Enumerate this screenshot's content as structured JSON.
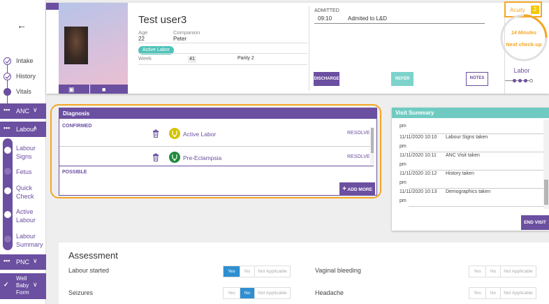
{
  "sidebar": {
    "back_icon": "arrow-left-icon",
    "steps": [
      {
        "label": "Intake",
        "state": "done"
      },
      {
        "label": "History",
        "state": "done"
      },
      {
        "label": "Vitals",
        "state": "current"
      }
    ],
    "groups": {
      "anc": {
        "label": "ANC"
      },
      "labour": {
        "label": "Labour"
      },
      "pnc": {
        "label": "PNC"
      },
      "wellbaby": {
        "label": "Well Baby Form"
      }
    },
    "labour_steps": [
      {
        "label": "Labour Signs",
        "state": "done"
      },
      {
        "label": "Fetus",
        "state": "todo"
      },
      {
        "label": "Quick Check",
        "state": "current"
      },
      {
        "label": "Active Labour",
        "state": "done"
      },
      {
        "label": "Labour Summary",
        "state": "todo"
      }
    ]
  },
  "patient": {
    "name": "Test user3",
    "age_label": "Age",
    "age": "22",
    "companion_label": "Companion",
    "companion": "Peter",
    "status_pill": "Active Labor",
    "week_label": "Week",
    "week": "41",
    "parity": "Parity 2",
    "admitted_label": "ADMITTED",
    "admit_time": "09:10",
    "admit_note": "Admited to L&D",
    "discharge_label": "DISCHARGE",
    "refer_label": "REFER",
    "notes_label": "NOTES",
    "acuity_label": "Acuity",
    "acuity_value": "2",
    "timer_minutes": "14 Minutes",
    "timer_next": "Next check-up",
    "stage_label": "Labor",
    "accent": "#6b4fa0",
    "warning": "#f5a623"
  },
  "diagnosis": {
    "title": "Diagnosis",
    "confirmed_label": "CONFIRMED",
    "possible_label": "POSSIBLE",
    "items": [
      {
        "name": "Active Labor",
        "action": "RESOLVE",
        "icon_color": "#d4c400"
      },
      {
        "name": "Pre-Eclampsia",
        "action": "RESOLVE",
        "icon_color": "#1f8a3a"
      }
    ],
    "add_more_label": "ADD MORE"
  },
  "visit_summary": {
    "title": "Visit Summary",
    "top_partial": "pm",
    "entries": [
      {
        "date": "11/11/2020 10:10",
        "ampm": "pm",
        "event": "Labour Signs taken"
      },
      {
        "date": "11/11/2020 10:11",
        "ampm": "pm",
        "event": "ANC Visit taken"
      },
      {
        "date": "11/11/2020 10:12",
        "ampm": "pm",
        "event": "History taken"
      },
      {
        "date": "11/11/2020 10:13",
        "ampm": "pm",
        "event": "Demographics taken"
      }
    ],
    "end_visit_label": "END VISIT"
  },
  "assessment": {
    "title": "Assessment",
    "options": [
      "Yes",
      "No",
      "Not Applicable"
    ],
    "questions": [
      {
        "label": "Labour started",
        "selected": "Yes"
      },
      {
        "label": "Vaginal bleeding",
        "selected": ""
      },
      {
        "label": "Seizures",
        "selected": "No"
      },
      {
        "label": "Headache",
        "selected": ""
      }
    ]
  }
}
